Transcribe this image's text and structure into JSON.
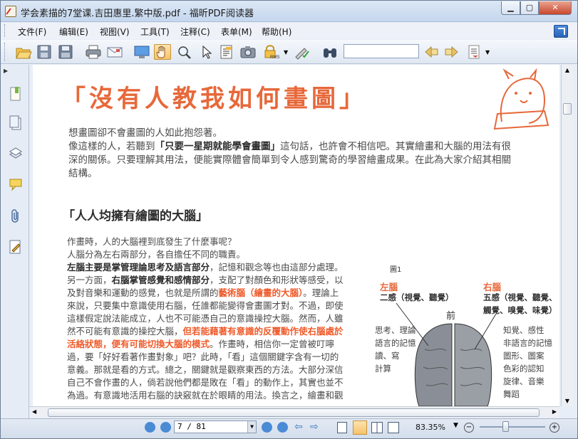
{
  "window": {
    "title": "学会素描的7堂课.吉田惠里.繁中版.pdf - 福昕PDF阅读器"
  },
  "menu": [
    "文件(F)",
    "编辑(E)",
    "视图(V)",
    "工具(T)",
    "注释(C)",
    "表单(M)",
    "帮助(H)"
  ],
  "toolbar": {
    "icons": [
      "open-icon",
      "save-icon",
      "save-as-icon",
      "print-icon",
      "email-icon",
      "fullscreen-icon",
      "hand-tool-icon",
      "zoom-tool-icon",
      "select-icon",
      "text-select-icon",
      "snapshot-icon",
      "rms-lock-icon",
      "sign-icon",
      "binoculars-icon",
      "find-previous-icon",
      "find-next-icon",
      "search-options-icon"
    ],
    "search_value": ""
  },
  "sidebar": [
    "bookmarks-icon",
    "pages-icon",
    "layers-icon",
    "comments-icon",
    "attachments-icon",
    "signatures-icon"
  ],
  "status": {
    "page_field": "7 / 81",
    "zoom": "83.35%"
  },
  "doc": {
    "h1": "「沒有人教我如何畫圖」",
    "intro1": "想畫圖卻不會畫圖的人如此抱怨著。",
    "intro2a": "像這樣的人，若聽到",
    "intro2b": "「只要一星期就能學會畫圖」",
    "intro2c": "這句話，也許會不相信吧。其實繪畫和大腦的用法有很",
    "intro3": "深的關係。只要理解其用法，便能實際體會簡單到令人感到驚奇的學習繪畫成果。在此為大家介紹其相關",
    "intro4": "結構。",
    "h2": "「人人均擁有繪圖的大腦」",
    "b1": "作畫時，人的大腦裡到底發生了什麼事呢？",
    "b2": "人腦分為左右兩部分，各自擔任不同的職責。",
    "b3a": "左腦主要是掌管理論思考及語言部分",
    "b3b": "，記憶和觀念等也由這部分處理。",
    "b4a": "另一方面，",
    "b4b": "右腦掌管感覺和感情部分",
    "b4c": "，支配了對顏色和形狀等感受，以",
    "b5a": "及對音樂和運動的感覺，也就是所謂的",
    "b5b": "藝術腦（繪畫的大腦）",
    "b5c": "。理論上",
    "b6": "來說，只要集中意識使用右腦，任誰都能變得會畫圖才對。不過，即使",
    "b7": "這樣假定說法能成立，人也不可能憑自己的意識操控大腦。然而，人雖",
    "b8a": "然不可能有意識的操控大腦，",
    "b8b": "但若能藉著有意識的反覆動作使右腦處於",
    "b9a": "活絡狀態，便有可能切換大腦的模式",
    "b9b": "。作畫時，相信你一定曾被叮嚀",
    "b10": "過，要「好好看著作畫對象」吧？此時，「看」這個關鍵字含有一切的",
    "b11": "意義。那就是看的方式。總之，關鍵就是觀察東西的方法。大部分深信",
    "b12": "自己不會作畫的人，倘若說他們都是敗在「看」的動作上，其實也並不",
    "b13": "為過。有意識地活用右腦的訣竅就在於眼睛的用法。換言之，繪畫和觀",
    "fig": "圖1",
    "left_brain": "左腦",
    "left_sub": "二感（視覺、聽覺）",
    "right_brain": "右腦",
    "right_sub1": "五感（視覺、聽覺、",
    "right_sub2": "觸覺、嗅覺、味覺）",
    "front": "前",
    "left_notes": [
      "思考、理論",
      "語言的記憶",
      "讀、寫",
      "計算"
    ],
    "right_notes": [
      "知覺、感性",
      "非語言的記憶",
      "圖形、圖案",
      "色彩的認知",
      "旋律、音樂",
      "舞蹈"
    ]
  },
  "colors": {
    "accent": "#e7683a",
    "highlight": "#ef5a2a"
  }
}
